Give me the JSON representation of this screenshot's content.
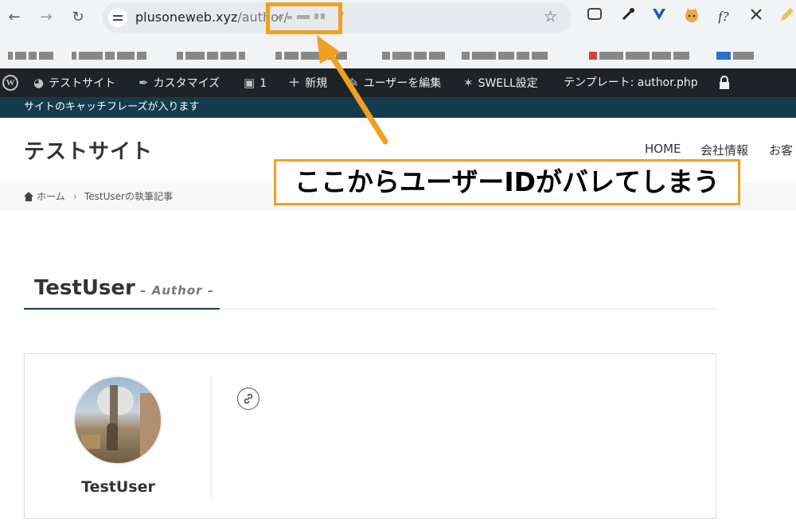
{
  "browser": {
    "url_host": "plusoneweb.xyz",
    "url_path": "/author/",
    "url_tail": "/",
    "icons": [
      "back-icon",
      "forward-icon",
      "reload-icon",
      "site-info-icon",
      "star-icon"
    ]
  },
  "extensions": {
    "formula_label": "f?"
  },
  "adminbar": {
    "site": "テストサイト",
    "customize": "カスタマイズ",
    "comments": "1",
    "new": "新規",
    "edit_user": "ユーザーを編集",
    "swell": "SWELL設定",
    "template": "テンプレート: author.php"
  },
  "catchphrase": "サイトのキャッチフレーズが入ります",
  "header": {
    "title": "テストサイト",
    "nav": [
      "HOME",
      "会社情報",
      "お客"
    ]
  },
  "breadcrumb": {
    "home": "ホーム",
    "separator": "›",
    "current": "TestUserの執筆記事"
  },
  "page": {
    "title": "TestUser",
    "subtitle": "– Author –"
  },
  "author": {
    "name": "TestUser"
  },
  "annotation": {
    "callout": "ここからユーザーIDがバレてしまう",
    "accent_color": "#f0a020"
  },
  "colors": {
    "adminbar_bg": "#1d2327",
    "catch_bg": "#153c4d"
  }
}
